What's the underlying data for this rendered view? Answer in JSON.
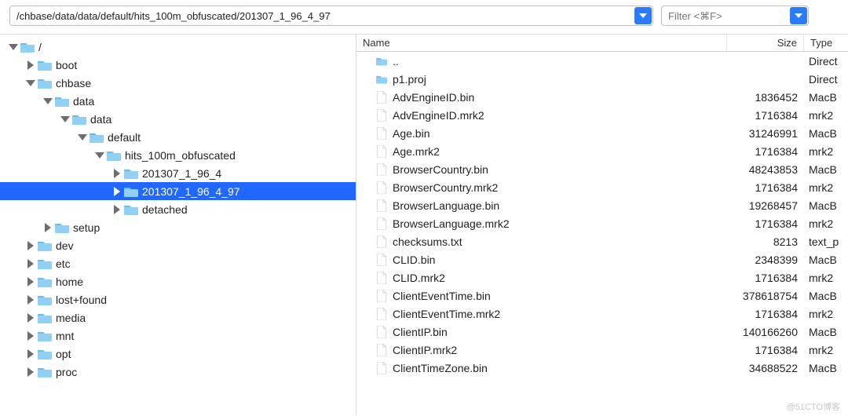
{
  "topbar": {
    "path": "/chbase/data/data/default/hits_100m_obfuscated/201307_1_96_4_97",
    "filter_placeholder": "Filter <⌘F>"
  },
  "tree": [
    {
      "depth": 0,
      "expanded": true,
      "hasChildren": true,
      "label": "/",
      "selected": false
    },
    {
      "depth": 1,
      "expanded": false,
      "hasChildren": true,
      "label": "boot",
      "selected": false
    },
    {
      "depth": 1,
      "expanded": true,
      "hasChildren": true,
      "label": "chbase",
      "selected": false
    },
    {
      "depth": 2,
      "expanded": true,
      "hasChildren": true,
      "label": "data",
      "selected": false
    },
    {
      "depth": 3,
      "expanded": true,
      "hasChildren": true,
      "label": "data",
      "selected": false
    },
    {
      "depth": 4,
      "expanded": true,
      "hasChildren": true,
      "label": "default",
      "selected": false
    },
    {
      "depth": 5,
      "expanded": true,
      "hasChildren": true,
      "label": "hits_100m_obfuscated",
      "selected": false
    },
    {
      "depth": 6,
      "expanded": false,
      "hasChildren": true,
      "label": "201307_1_96_4",
      "selected": false
    },
    {
      "depth": 6,
      "expanded": false,
      "hasChildren": true,
      "label": "201307_1_96_4_97",
      "selected": true
    },
    {
      "depth": 6,
      "expanded": false,
      "hasChildren": true,
      "label": "detached",
      "selected": false
    },
    {
      "depth": 2,
      "expanded": false,
      "hasChildren": true,
      "label": "setup",
      "selected": false
    },
    {
      "depth": 1,
      "expanded": false,
      "hasChildren": true,
      "label": "dev",
      "selected": false
    },
    {
      "depth": 1,
      "expanded": false,
      "hasChildren": true,
      "label": "etc",
      "selected": false
    },
    {
      "depth": 1,
      "expanded": false,
      "hasChildren": true,
      "label": "home",
      "selected": false
    },
    {
      "depth": 1,
      "expanded": false,
      "hasChildren": true,
      "label": "lost+found",
      "selected": false
    },
    {
      "depth": 1,
      "expanded": false,
      "hasChildren": true,
      "label": "media",
      "selected": false
    },
    {
      "depth": 1,
      "expanded": false,
      "hasChildren": true,
      "label": "mnt",
      "selected": false
    },
    {
      "depth": 1,
      "expanded": false,
      "hasChildren": true,
      "label": "opt",
      "selected": false
    },
    {
      "depth": 1,
      "expanded": false,
      "hasChildren": true,
      "label": "proc",
      "selected": false
    }
  ],
  "list": {
    "columns": {
      "name": "Name",
      "size": "Size",
      "type": "Type"
    },
    "rows": [
      {
        "icon": "folder",
        "name": "..",
        "size": "",
        "type": "Direct"
      },
      {
        "icon": "folder",
        "name": "p1.proj",
        "size": "",
        "type": "Direct"
      },
      {
        "icon": "file",
        "name": "AdvEngineID.bin",
        "size": "1836452",
        "type": "MacB"
      },
      {
        "icon": "file",
        "name": "AdvEngineID.mrk2",
        "size": "1716384",
        "type": "mrk2"
      },
      {
        "icon": "file",
        "name": "Age.bin",
        "size": "31246991",
        "type": "MacB"
      },
      {
        "icon": "file",
        "name": "Age.mrk2",
        "size": "1716384",
        "type": "mrk2"
      },
      {
        "icon": "file",
        "name": "BrowserCountry.bin",
        "size": "48243853",
        "type": "MacB"
      },
      {
        "icon": "file",
        "name": "BrowserCountry.mrk2",
        "size": "1716384",
        "type": "mrk2"
      },
      {
        "icon": "file",
        "name": "BrowserLanguage.bin",
        "size": "19268457",
        "type": "MacB"
      },
      {
        "icon": "file",
        "name": "BrowserLanguage.mrk2",
        "size": "1716384",
        "type": "mrk2"
      },
      {
        "icon": "file",
        "name": "checksums.txt",
        "size": "8213",
        "type": "text_p"
      },
      {
        "icon": "file",
        "name": "CLID.bin",
        "size": "2348399",
        "type": "MacB"
      },
      {
        "icon": "file",
        "name": "CLID.mrk2",
        "size": "1716384",
        "type": "mrk2"
      },
      {
        "icon": "file",
        "name": "ClientEventTime.bin",
        "size": "378618754",
        "type": "MacB"
      },
      {
        "icon": "file",
        "name": "ClientEventTime.mrk2",
        "size": "1716384",
        "type": "mrk2"
      },
      {
        "icon": "file",
        "name": "ClientIP.bin",
        "size": "140166260",
        "type": "MacB"
      },
      {
        "icon": "file",
        "name": "ClientIP.mrk2",
        "size": "1716384",
        "type": "mrk2"
      },
      {
        "icon": "file",
        "name": "ClientTimeZone.bin",
        "size": "34688522",
        "type": "MacB"
      }
    ]
  },
  "watermark": "@51CTO博客"
}
